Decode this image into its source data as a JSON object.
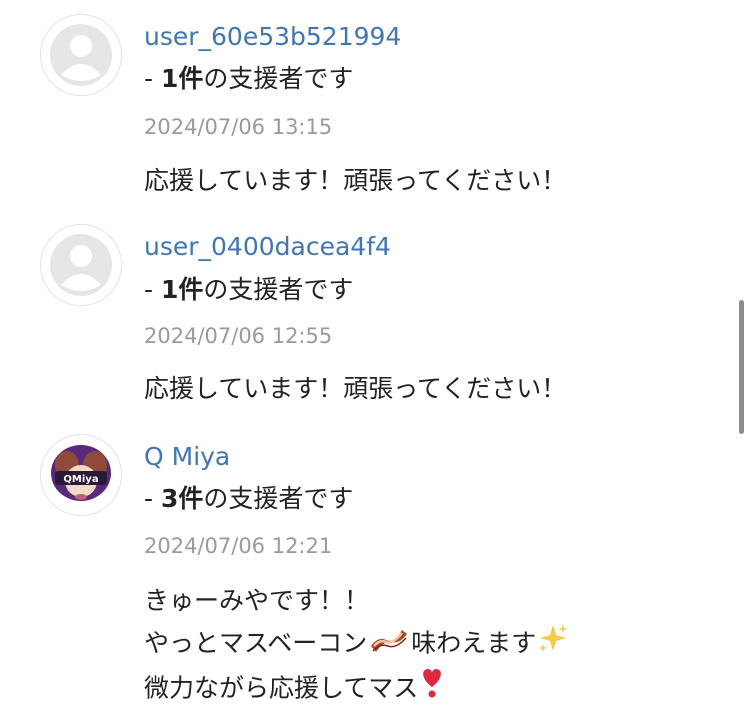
{
  "comments": [
    {
      "username": "user_60e53b521994",
      "supporter_prefix": "- ",
      "supporter_count": "1件",
      "supporter_suffix": "の支援者です",
      "timestamp": "2024/07/06 13:15",
      "avatar": "default-avatar-icon",
      "message_lines": [
        "応援しています！頑張ってください！"
      ]
    },
    {
      "username": "user_0400dacea4f4",
      "supporter_prefix": "- ",
      "supporter_count": "1件",
      "supporter_suffix": "の支援者です",
      "timestamp": "2024/07/06 12:55",
      "avatar": "default-avatar-icon",
      "message_lines": [
        "応援しています！頑張ってください！"
      ]
    },
    {
      "username": "Q Miya",
      "supporter_prefix": "- ",
      "supporter_count": "3件",
      "supporter_suffix": "の支援者です",
      "timestamp": "2024/07/06 12:21",
      "avatar": "profile-avatar-image",
      "message_lines": [
        "きゅーみやです！！",
        "やっとマスベーコン",
        "味わえます",
        "微力ながら応援してマス"
      ],
      "emojis": [
        "bacon-emoji",
        "sparkles-emoji",
        "heart-exclamation-emoji"
      ]
    }
  ],
  "colors": {
    "username": "#3f76b3",
    "timestamp": "#9a9a9a",
    "text": "#222222",
    "avatar_placeholder": "#e6e6e6"
  }
}
